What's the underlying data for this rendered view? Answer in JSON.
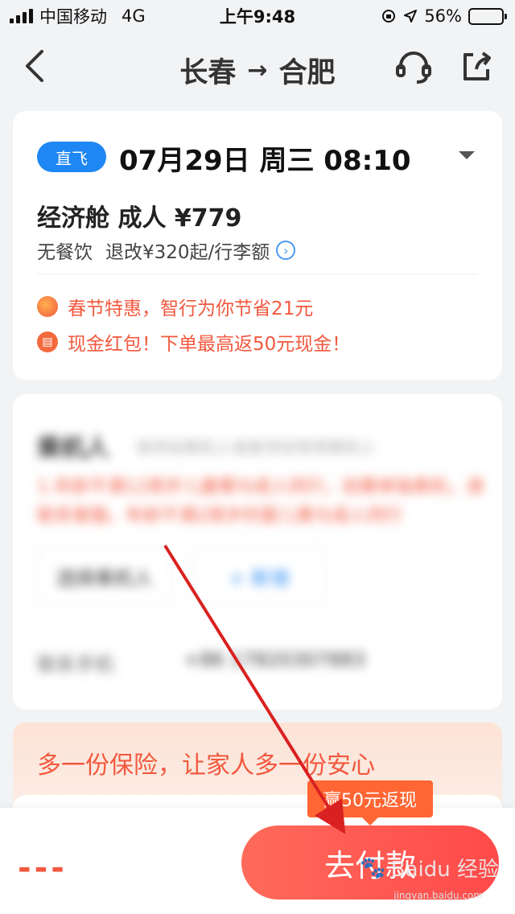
{
  "status_bar": {
    "carrier": "中国移动",
    "network": "4G",
    "time": "上午9:48",
    "battery": "56%",
    "battery_level": 0.56
  },
  "nav": {
    "origin": "长春",
    "arrow": "→",
    "destination": "合肥"
  },
  "flight": {
    "badge": "直飞",
    "date": "07月29日 周三 08:10",
    "cabin": "经济舱 成人 ¥779",
    "meal": "无餐饮",
    "refund": "退改¥320起/行李额",
    "promos": [
      {
        "icon": "fan-icon",
        "text": "春节特惠，智行为你节省21元"
      },
      {
        "icon": "cash-envelope-icon",
        "text": "现金红包！下单最高返50元现金！"
      }
    ]
  },
  "passenger": {
    "title": "乘机人",
    "subtitle": "请添加乘机人或者添加常用乘机人",
    "warning": "1.年龄不满12周岁儿童需与成人同行，如需单独乘机，请联系客服。年龄不满2周岁的婴儿需与成人同行",
    "btn_select": "选择乘机人",
    "btn_add": "+ 新增",
    "phone_label": "联系手机",
    "phone": "+86 17820307883"
  },
  "insurance": {
    "text": "多一份保险，让家人多一份安心"
  },
  "bottom": {
    "price_placeholder": "---",
    "cashback": "赢50元返现",
    "pay_label": "去付款"
  },
  "watermark": {
    "text": "Baidu 经验",
    "url": "jingyan.baidu.com"
  },
  "colors": {
    "accent_blue": "#1f87f3",
    "accent_red": "#f2583e",
    "pay_button": "#ff4a4a",
    "annotation_arrow": "#d92121"
  }
}
